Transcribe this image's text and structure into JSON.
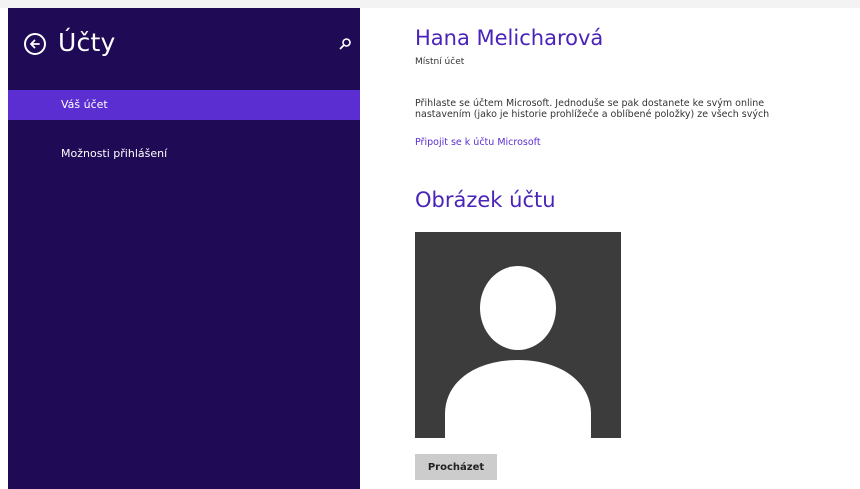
{
  "sidebar": {
    "title": "Účty",
    "back_icon": "back-arrow-icon",
    "search_icon": "search-icon",
    "items": [
      {
        "label": "Váš účet",
        "selected": true
      },
      {
        "label": "Možnosti přihlášení",
        "selected": false
      }
    ],
    "background_color": "#1e0a55",
    "selected_color": "#5b2ed2"
  },
  "account": {
    "name": "Hana Melicharová",
    "type": "Místní účet",
    "description_line1": "Přihlaste se účtem Microsoft. Jednoduše se pak dostanete ke svým online",
    "description_line2": "nastavením (jako je historie prohlížeče a oblíbené položky) ze všech svých",
    "connect_link": "Připojit se k účtu Microsoft"
  },
  "picture_section": {
    "title": "Obrázek účtu",
    "avatar_icon": "default-user-avatar-icon",
    "browse_label": "Procházet"
  },
  "colors": {
    "accent": "#4a23b8",
    "link": "#5b2ed2"
  }
}
